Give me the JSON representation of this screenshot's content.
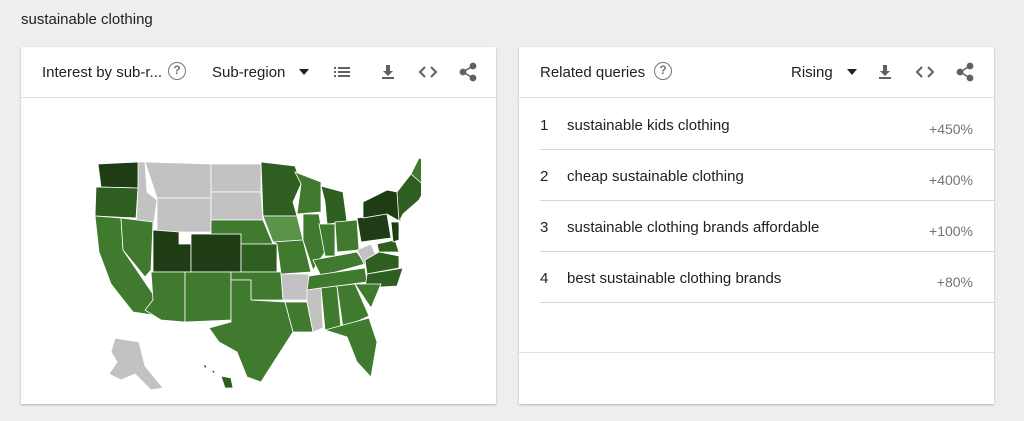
{
  "search_term": "sustainable clothing",
  "interest_card": {
    "title": "Interest by sub-r...",
    "help_icon": "help-circle-icon",
    "dropdown_label": "Sub-region",
    "icons": [
      "list-icon",
      "download-icon",
      "embed-code-icon",
      "share-icon"
    ]
  },
  "related_card": {
    "title": "Related queries",
    "help_icon": "help-circle-icon",
    "dropdown_label": "Rising",
    "icons": [
      "download-icon",
      "embed-code-icon",
      "share-icon"
    ],
    "queries": [
      {
        "rank": "1",
        "text": "sustainable kids clothing",
        "value": "+450%"
      },
      {
        "rank": "2",
        "text": "cheap sustainable clothing",
        "value": "+400%"
      },
      {
        "rank": "3",
        "text": "sustainable clothing brands affordable",
        "value": "+100%"
      },
      {
        "rank": "4",
        "text": "best sustainable clothing brands",
        "value": "+80%"
      }
    ]
  },
  "colors": {
    "dark_green": "#1f3d14",
    "mid_green": "#2e5e20",
    "green": "#3f7a2e",
    "light_green": "#5a9249",
    "no_data_gray": "#c2c2c2"
  }
}
